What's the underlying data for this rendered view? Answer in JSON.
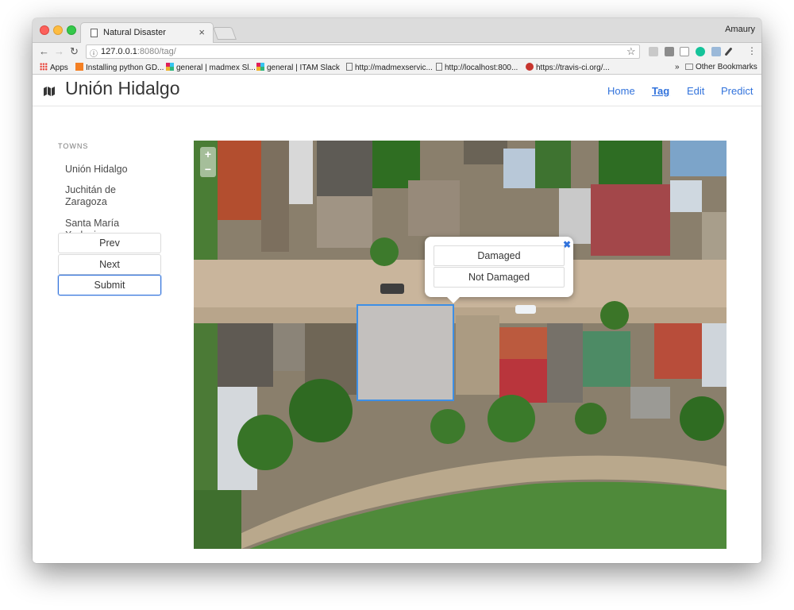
{
  "browser": {
    "tab_title": "Natural Disaster",
    "tab_close": "×",
    "profile": "Amaury",
    "url_host": "127.0.0.1",
    "url_path": ":8080/tag/",
    "info_icon": "ⓘ",
    "star": "☆",
    "overflow": "»"
  },
  "bookmarks": [
    {
      "label": "Apps",
      "icon": "apps-grid-icon",
      "color": "#e8453c"
    },
    {
      "label": "Installing python GD...",
      "icon": "stack-overflow-icon",
      "color": "#f48024"
    },
    {
      "label": "general | madmex Sl...",
      "icon": "slack-icon",
      "color": "#e01e5a"
    },
    {
      "label": "general | ITAM Slack",
      "icon": "slack-icon",
      "color": "#e01e5a"
    },
    {
      "label": "http://madmexservic...",
      "icon": "page-icon",
      "color": "#777777"
    },
    {
      "label": "http://localhost:800...",
      "icon": "page-icon",
      "color": "#777777"
    },
    {
      "label": "https://travis-ci.org/...",
      "icon": "travis-icon",
      "color": "#c7352e"
    },
    {
      "label": "Other Bookmarks",
      "icon": "folder-icon",
      "color": "#888888"
    }
  ],
  "app": {
    "title": "Unión Hidalgo",
    "nav": [
      "Home",
      "Tag",
      "Edit",
      "Predict"
    ],
    "active_nav": "Tag",
    "accent": "#3273dc"
  },
  "sidebar": {
    "label": "TOWNS",
    "towns": [
      "Unión Hidalgo",
      "Juchitán de Zaragoza",
      "Santa María Xadani"
    ],
    "buttons": [
      "Prev",
      "Next",
      "Submit"
    ]
  },
  "map": {
    "zoom_in": "+",
    "zoom_out": "−",
    "popup_options": [
      "Damaged",
      "Not Damaged"
    ],
    "popup_close": "✖"
  }
}
